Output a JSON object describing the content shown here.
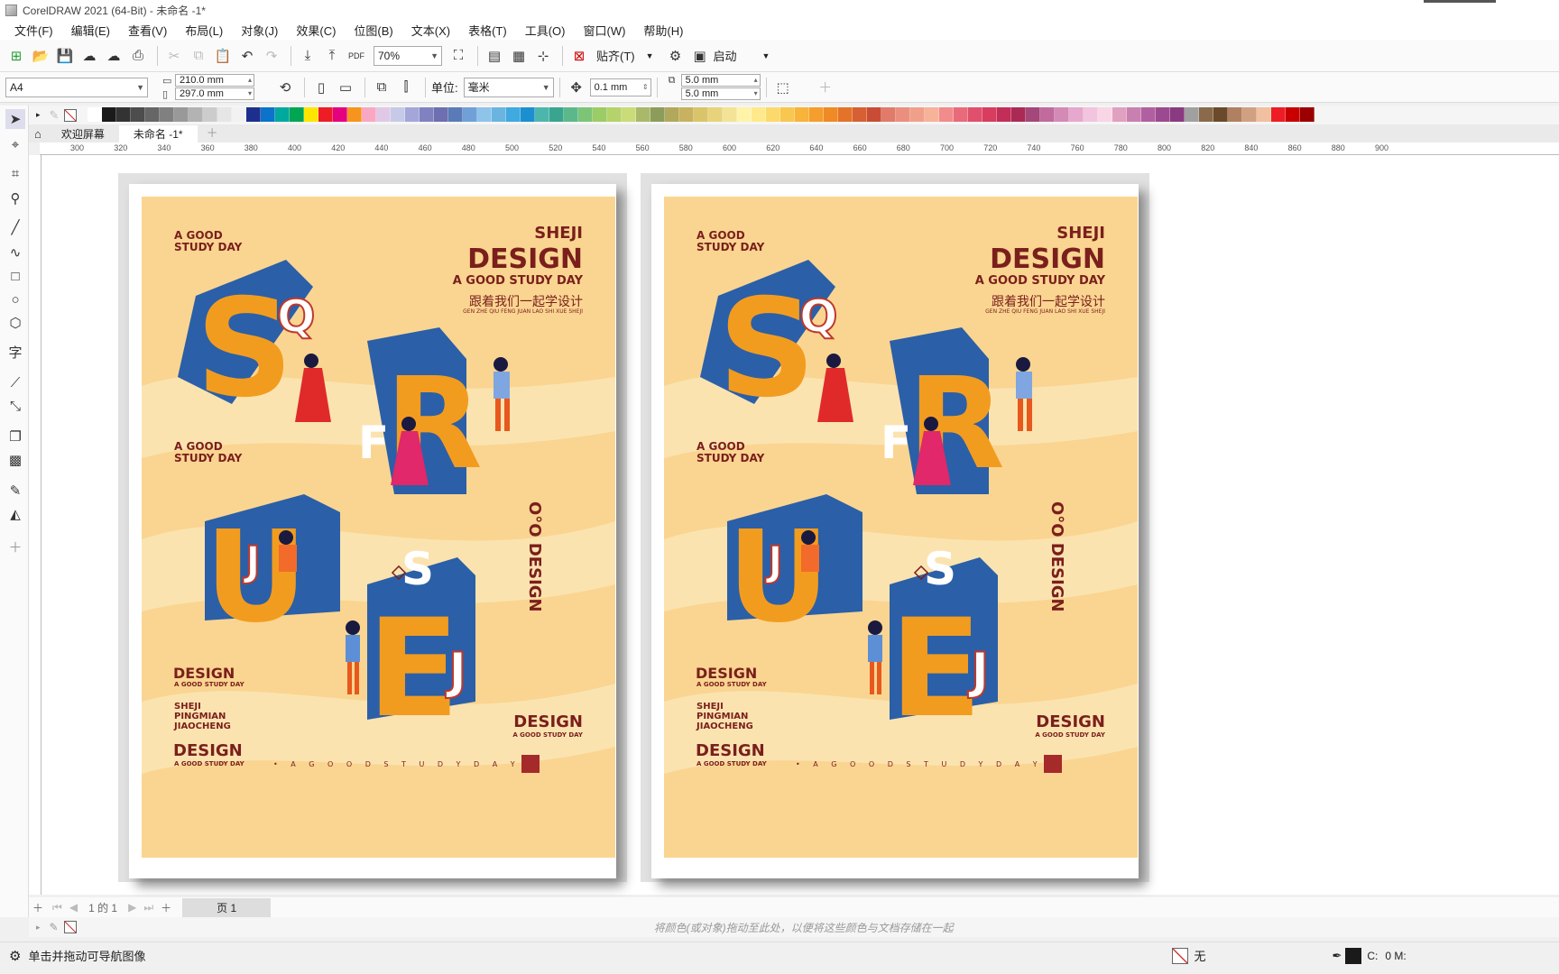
{
  "window": {
    "title": "CorelDRAW 2021 (64-Bit) - 未命名 -1*"
  },
  "menu": [
    "文件(F)",
    "编辑(E)",
    "查看(V)",
    "布局(L)",
    "对象(J)",
    "效果(C)",
    "位图(B)",
    "文本(X)",
    "表格(T)",
    "工具(O)",
    "窗口(W)",
    "帮助(H)"
  ],
  "toolbar": {
    "zoom": "70%",
    "snap_label": "贴齐(T)",
    "launch_label": "启动",
    "pdf_label": "PDF"
  },
  "props": {
    "page_size": "A4",
    "width": "210.0 mm",
    "height": "297.0 mm",
    "units_label": "单位:",
    "units_value": "毫米",
    "nudge": "0.1 mm",
    "dup_x": "5.0 mm",
    "dup_y": "5.0 mm"
  },
  "tabs": {
    "welcome": "欢迎屏幕",
    "doc": "未命名 -1*"
  },
  "ruler": {
    "h_ticks": [
      "300",
      "320",
      "340",
      "360",
      "380",
      "400",
      "420",
      "440",
      "460",
      "480",
      "500",
      "520",
      "540",
      "560",
      "580",
      "600",
      "620",
      "640",
      "660",
      "680",
      "700",
      "720",
      "740",
      "760",
      "780",
      "800",
      "820",
      "840",
      "860",
      "880",
      "900"
    ]
  },
  "palette": [
    "#ffffff",
    "#1a1a1a",
    "#333333",
    "#4d4d4d",
    "#666666",
    "#808080",
    "#999999",
    "#b3b3b3",
    "#cccccc",
    "#e6e6e6",
    "#f2f2f2",
    "#1d2f8c",
    "#0b73c9",
    "#00a99d",
    "#00a651",
    "#ffe600",
    "#ee1c25",
    "#e4007f",
    "#f7941d",
    "#f9a8c4",
    "#e0c9e6",
    "#c7c9e8",
    "#a4a6d9",
    "#8081c1",
    "#6c6fb0",
    "#5a7ab8",
    "#6fa0d8",
    "#8ec3ea",
    "#6ab4e0",
    "#3fa9e0",
    "#1b8fcf",
    "#4db6ac",
    "#3aa58f",
    "#5cb88a",
    "#7cc576",
    "#9ccc65",
    "#b5d36a",
    "#c9dc78",
    "#a9b86b",
    "#8c9d5b",
    "#b1a85b",
    "#c8b25f",
    "#d9c46a",
    "#e8d37b",
    "#f2e396",
    "#fff3a8",
    "#ffe98a",
    "#fcd96b",
    "#f9c650",
    "#f7b33a",
    "#f59e2d",
    "#f08a24",
    "#e4732a",
    "#d66033",
    "#c94c36",
    "#e07b6a",
    "#ea8f7e",
    "#f0a08a",
    "#f7b29a",
    "#f28b8b",
    "#e96a7a",
    "#e04f6b",
    "#d83c5e",
    "#c22e58",
    "#ab2a55",
    "#a4477a",
    "#c06a9d",
    "#d48ab7",
    "#e6a8cd",
    "#f2c4dd",
    "#f9d6e6",
    "#e0a0c0",
    "#c880b0",
    "#b060a0",
    "#9c4a90",
    "#8a3a80",
    "#a0a0a0",
    "#8a6a4a",
    "#6a4a2a",
    "#b08060",
    "#d0a080",
    "#f0c0a0",
    "#ee1c25",
    "#c80000",
    "#9a0000"
  ],
  "posters": [
    {
      "a_good": "A GOOD",
      "study_day": "STUDY DAY",
      "sheji": "SHEJI",
      "design_big": "DESIGN",
      "subtitle": "A GOOD STUDY DAY",
      "cn_line": "跟着我们一起学设计",
      "pinyin": "GEN ZHE QIU FENG JUAN LAO SHI XUE SHEJI",
      "a_good2": "A GOOD",
      "study_day2": "STUDY DAY",
      "vertical": "O°O DESIGN",
      "design_l1": "DESIGN",
      "small_l1": "A GOOD STUDY DAY",
      "sheji_l": "SHEJI",
      "pingmian": "PINGMIAN",
      "jiaocheng": "JIAOCHENG",
      "design_l2": "DESIGN",
      "small_l2": "A GOOD STUDY DAY",
      "design_r": "DESIGN",
      "small_r": "A GOOD STUDY DAY",
      "dots": "• A G O O D S T U D Y D A Y •"
    },
    {
      "a_good": "A GOOD",
      "study_day": "STUDY DAY",
      "sheji": "SHEJI",
      "design_big": "DESIGN",
      "subtitle": "A GOOD STUDY DAY",
      "cn_line": "跟着我们一起学设计",
      "pinyin": "GEN ZHE QIU FENG JUAN LAO SHI XUE SHEJI",
      "a_good2": "A GOOD",
      "study_day2": "STUDY DAY",
      "vertical": "O°O DESIGN",
      "design_l1": "DESIGN",
      "small_l1": "A GOOD STUDY DAY",
      "sheji_l": "SHEJI",
      "pingmian": "PINGMIAN",
      "jiaocheng": "JIAOCHENG",
      "design_l2": "DESIGN",
      "small_l2": "A GOOD STUDY DAY",
      "design_r": "DESIGN",
      "small_r": "A GOOD STUDY DAY",
      "dots": "• A G O O D S T U D Y D A Y •"
    }
  ],
  "pagenav": {
    "count": "1 的 1",
    "page_tab": "页 1"
  },
  "palette_hint": "将颜色(或对象)拖动至此处，以便将这些颜色与文档存储在一起",
  "status": {
    "message": "单击并拖动可导航图像",
    "fill_label": "无",
    "color_c": "C:",
    "color_m": "0 M:"
  }
}
